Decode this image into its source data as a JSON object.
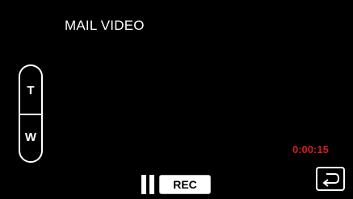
{
  "screen": {
    "mode_title": "MAIL VIDEO",
    "recording_time": "0:00:15",
    "recording_time_color": "#d41d26"
  },
  "zoom": {
    "tele_label": "T",
    "wide_label": "W"
  },
  "controls": {
    "pause_icon": "pause-icon",
    "rec_label": "REC",
    "back_icon": "return-arrow-icon"
  }
}
